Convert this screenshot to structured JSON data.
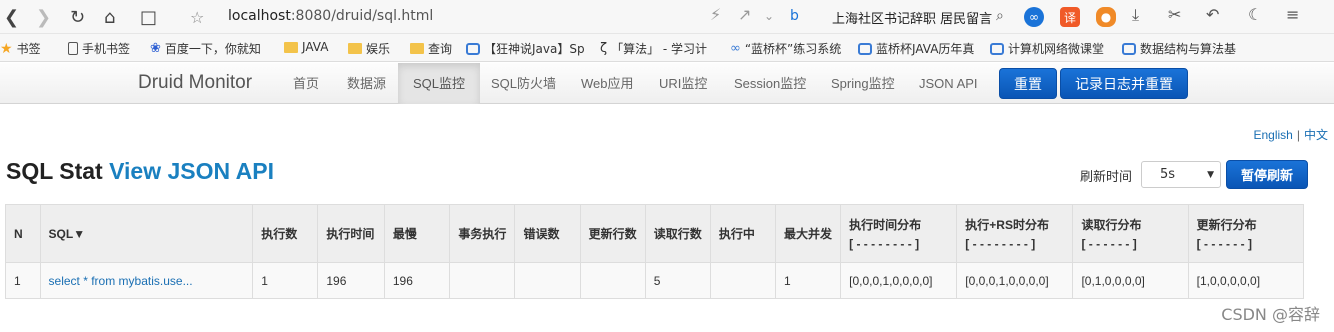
{
  "browser": {
    "url_host": "localhost",
    "url_rest": ":8080/druid/sql.html",
    "news_text": "上海社区书记辞职 居民留言",
    "bookmarks": [
      "书签",
      "手机书签",
      "百度一下，你就知",
      "JAVA",
      "娱乐",
      "查询",
      "【狂神说Java】Sp",
      "「算法」 - 学习计",
      "“蓝桥杯”练习系统",
      "蓝桥杯JAVA历年真",
      "计算机网络微课堂",
      "数据结构与算法基"
    ]
  },
  "druid_nav": {
    "brand": "Druid Monitor",
    "items": [
      "首页",
      "数据源",
      "SQL监控",
      "SQL防火墙",
      "Web应用",
      "URI监控",
      "Session监控",
      "Spring监控",
      "JSON API"
    ],
    "reset_label": "重置",
    "log_reset_label": "记录日志并重置"
  },
  "lang": {
    "english": "English",
    "chinese": "中文",
    "sep": "|"
  },
  "page": {
    "title": "SQL Stat",
    "title_link": "View JSON API",
    "refresh_label": "刷新时间",
    "refresh_value": "5s",
    "pause_label": "暂停刷新"
  },
  "table": {
    "headers": [
      {
        "label": "N"
      },
      {
        "label": "SQL▼"
      },
      {
        "label": "执行数"
      },
      {
        "label": "执行时间"
      },
      {
        "label": "最慢"
      },
      {
        "label": "事务执行"
      },
      {
        "label": "错误数"
      },
      {
        "label": "更新行数"
      },
      {
        "label": "读取行数"
      },
      {
        "label": "执行中"
      },
      {
        "label": "最大并发"
      },
      {
        "label": "执行时间分布",
        "sub": "[ - - - - - - - - ]"
      },
      {
        "label": "执行+RS时分布",
        "sub": "[ - - - - - - - - ]"
      },
      {
        "label": "读取行分布",
        "sub": "[ - - - - - - ]"
      },
      {
        "label": "更新行分布",
        "sub": "[ - - - - - - ]"
      }
    ],
    "rows": [
      [
        "1",
        "select * from mybatis.use...",
        "1",
        "196",
        "196",
        "",
        "",
        "",
        "5",
        "",
        "1",
        "[0,0,0,1,0,0,0,0]",
        "[0,0,0,1,0,0,0,0]",
        "[0,1,0,0,0,0]",
        "[1,0,0,0,0,0]"
      ]
    ]
  },
  "watermark": "CSDN @容辞"
}
